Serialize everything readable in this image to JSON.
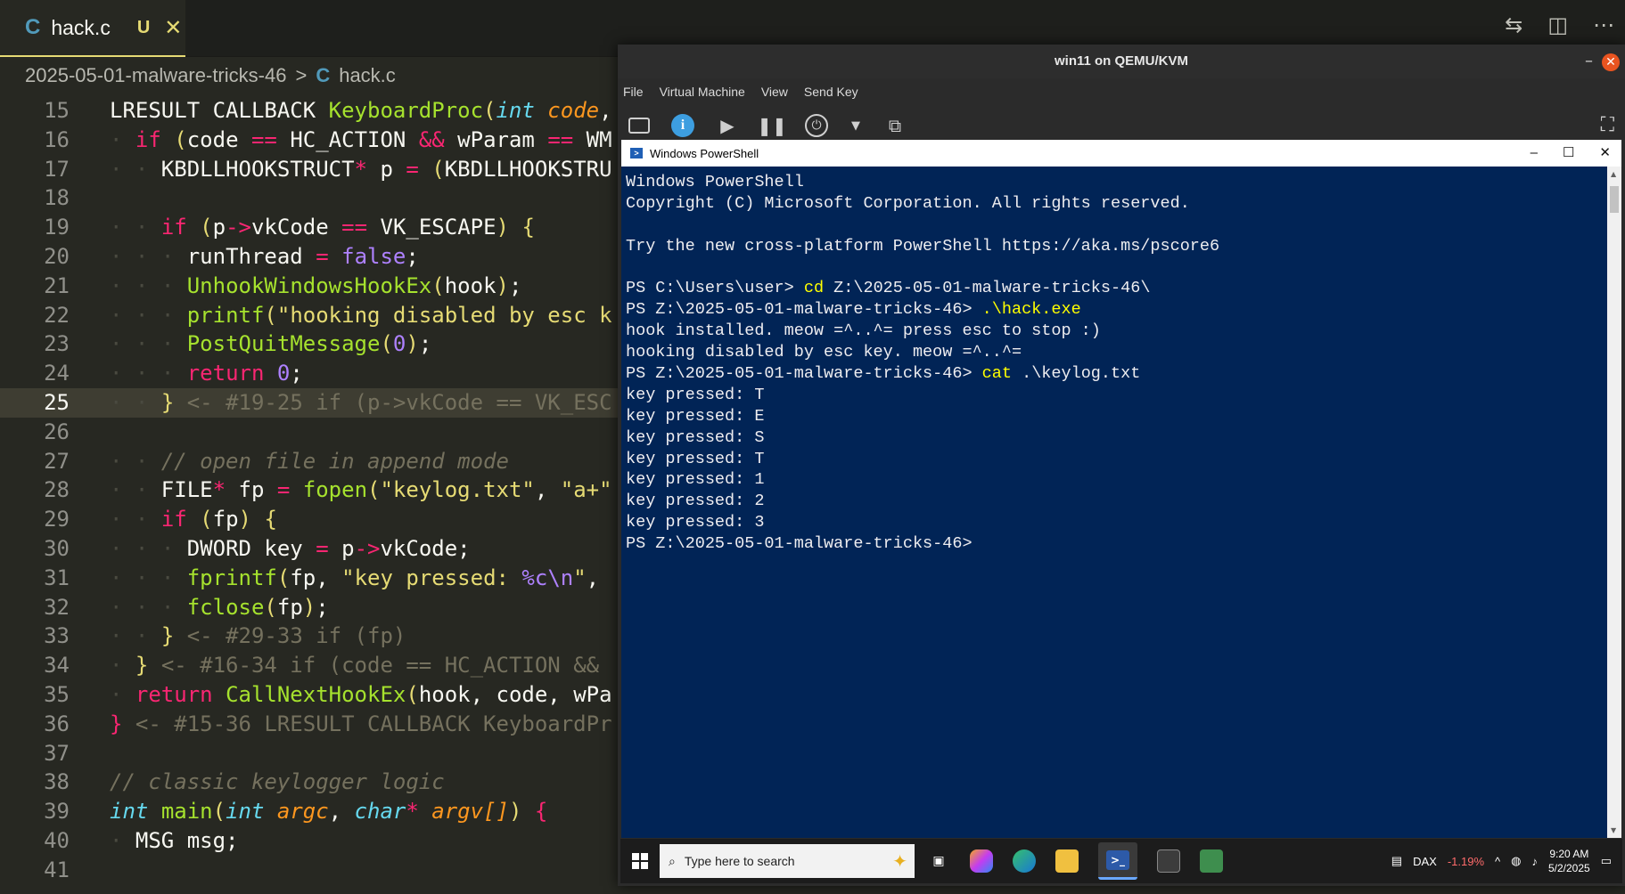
{
  "editor": {
    "tab": {
      "icon": "C",
      "name": "hack.c",
      "status": "U",
      "close": "✕"
    },
    "breadcrumb": {
      "folder": "2025-05-01-malware-tricks-46",
      "sep": ">",
      "icon": "C",
      "file": "hack.c"
    }
  },
  "vm": {
    "title": "win11 on QEMU/KVM",
    "menu": [
      "File",
      "Virtual Machine",
      "View",
      "Send Key"
    ],
    "powershell": {
      "title": "Windows PowerShell",
      "lines": [
        {
          "text": "Windows PowerShell"
        },
        {
          "text": "Copyright (C) Microsoft Corporation. All rights reserved."
        },
        {
          "text": ""
        },
        {
          "text": "Try the new cross-platform PowerShell https://aka.ms/pscore6"
        },
        {
          "text": ""
        },
        {
          "prompt": "PS C:\\Users\\user> ",
          "cmd": "cd",
          "args": " Z:\\2025-05-01-malware-tricks-46\\"
        },
        {
          "prompt": "PS Z:\\2025-05-01-malware-tricks-46> ",
          "cmd": ".\\hack.exe",
          "args": ""
        },
        {
          "text": "hook installed. meow =^..^= press esc to stop :)"
        },
        {
          "text": "hooking disabled by esc key. meow =^..^="
        },
        {
          "prompt": "PS Z:\\2025-05-01-malware-tricks-46> ",
          "cmd": "cat",
          "args": " .\\keylog.txt"
        },
        {
          "text": "key pressed: T"
        },
        {
          "text": "key pressed: E"
        },
        {
          "text": "key pressed: S"
        },
        {
          "text": "key pressed: T"
        },
        {
          "text": "key pressed: 1"
        },
        {
          "text": "key pressed: 2"
        },
        {
          "text": "key pressed: 3"
        },
        {
          "text": "PS Z:\\2025-05-01-malware-tricks-46>"
        }
      ]
    },
    "taskbar": {
      "search_placeholder": "Type here to search",
      "stock_name": "DAX",
      "stock_change": "-1.19%",
      "time": "9:20 AM",
      "date": "5/2/2025"
    }
  },
  "colors": {
    "editor_bg": "#272822",
    "keyword": "#f92672",
    "function": "#a6e22e",
    "string": "#e6db74",
    "number": "#ae81ff",
    "type": "#66d9ef",
    "comment": "#75715e",
    "powershell_bg": "#012456",
    "powershell_cmd": "#ffff00"
  },
  "icons": [
    "c-file-icon",
    "close-icon",
    "source-control-icon",
    "split-editor-icon",
    "more-icon",
    "chevron-right-icon",
    "monitor-icon",
    "info-icon",
    "play-icon",
    "pause-icon",
    "power-icon",
    "dropdown-icon",
    "screenshot-icon",
    "fullscreen-icon",
    "minimize-icon",
    "maximize-icon",
    "windows-start-icon",
    "search-icon",
    "task-view-icon",
    "copilot-icon",
    "edge-icon",
    "file-explorer-icon",
    "powershell-icon",
    "terminal-icon",
    "app-icon"
  ]
}
